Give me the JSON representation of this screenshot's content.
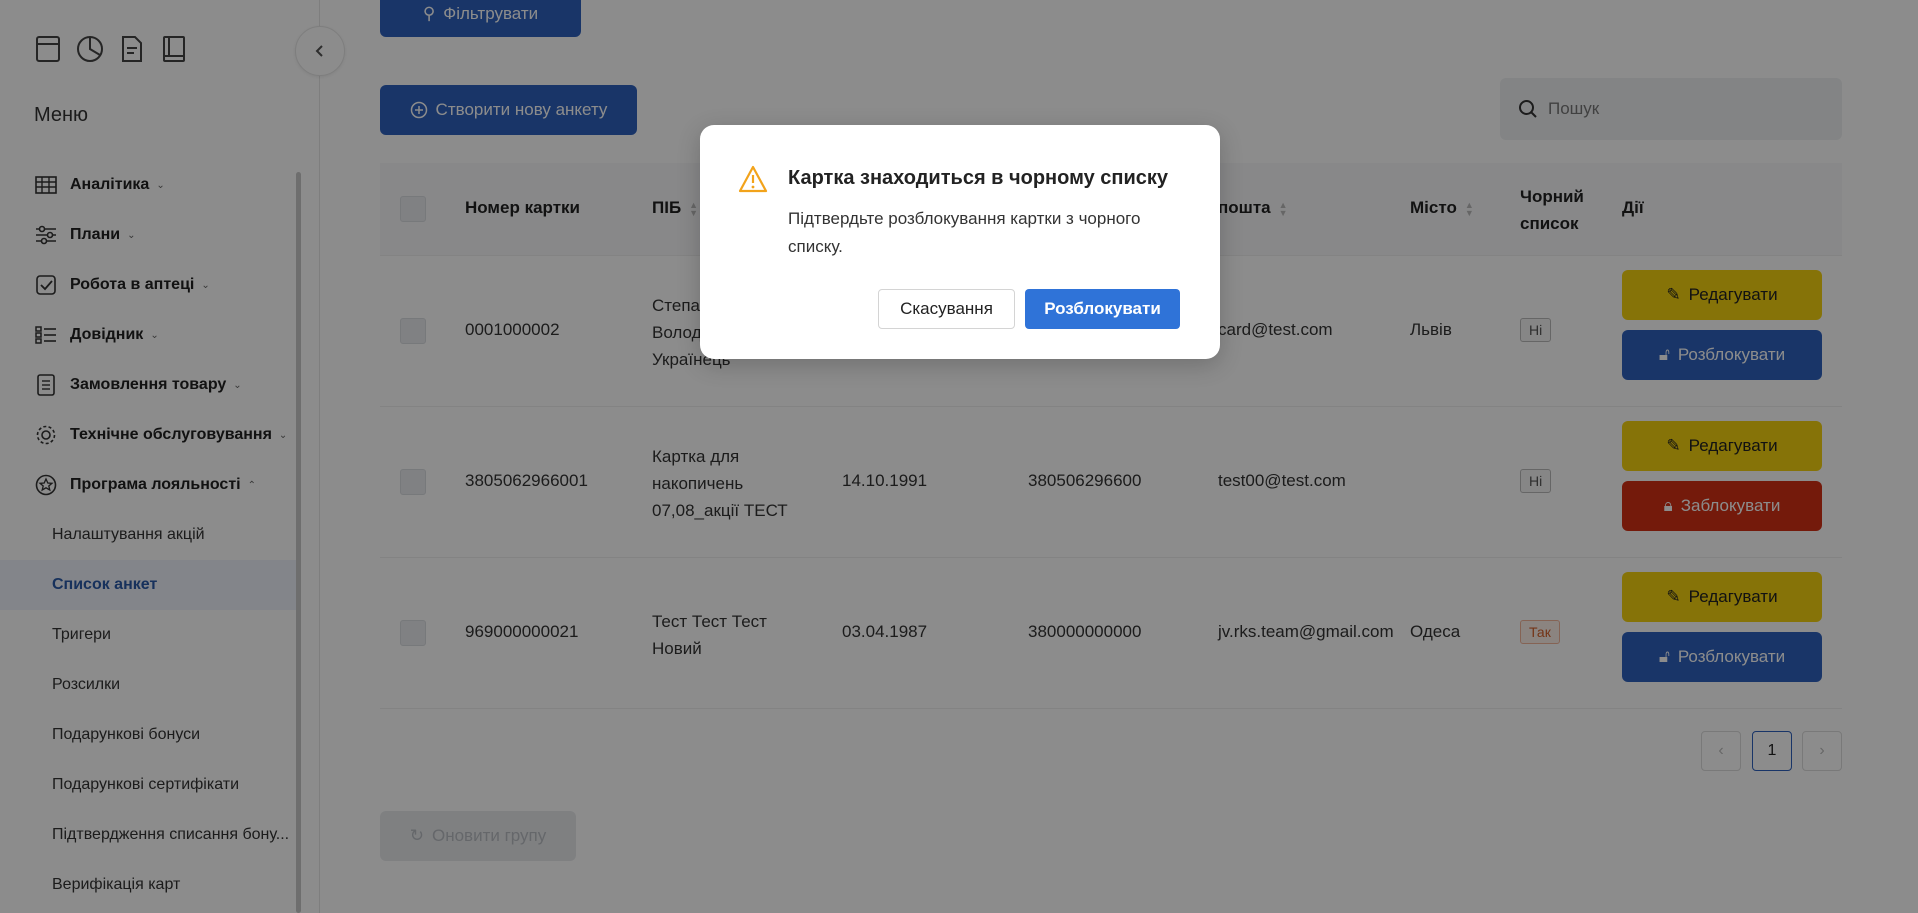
{
  "sidebar": {
    "top_icons": [
      "archive-icon",
      "pie-chart-icon",
      "document-icon",
      "book-icon"
    ],
    "menu_title": "Меню",
    "items": [
      {
        "label": "Аналітика",
        "icon": "table-grid-icon",
        "expanded": false
      },
      {
        "label": "Плани",
        "icon": "sliders-icon",
        "expanded": false
      },
      {
        "label": "Робота в аптеці",
        "icon": "checkbox-icon",
        "expanded": false
      },
      {
        "label": "Довідник",
        "icon": "list-icon",
        "expanded": false
      },
      {
        "label": "Замовлення товару",
        "icon": "clipboard-list-icon",
        "expanded": false
      },
      {
        "label": "Технічне обслуговування",
        "icon": "gear-icon",
        "expanded": false
      },
      {
        "label": "Програма лояльності",
        "icon": "star-badge-icon",
        "expanded": true
      }
    ],
    "sub_items": [
      {
        "label": "Налаштування акцій",
        "active": false
      },
      {
        "label": "Список анкет",
        "active": true
      },
      {
        "label": "Тригери",
        "active": false
      },
      {
        "label": "Розсилки",
        "active": false
      },
      {
        "label": "Подарункові бонуси",
        "active": false
      },
      {
        "label": "Подарункові сертифікати",
        "active": false
      },
      {
        "label": "Підтвердження списання бону...",
        "active": false
      },
      {
        "label": "Верифікація карт",
        "active": false
      }
    ]
  },
  "toolbar": {
    "filter_label": "Фільтрувати",
    "create_label": "Створити нову анкету",
    "search_placeholder": "Пошук"
  },
  "table": {
    "headers": {
      "card_number": "Номер картки",
      "name": "ПІБ",
      "email": "пошта",
      "city": "Місто",
      "blacklist": "Чорний список",
      "actions": "Дії"
    },
    "rows": [
      {
        "card_number": "0001000002",
        "name": "Степа... Волод... Українець",
        "name_lines": [
          "Степа",
          "Волод",
          "Українець"
        ],
        "birth_date": "",
        "phone": "",
        "email": "card@test.com",
        "city": "Львів",
        "blacklist": "Ні",
        "blacklisted": false,
        "action_primary": "Редагувати",
        "action_secondary": "Розблокувати",
        "secondary_type": "unblock"
      },
      {
        "card_number": "3805062966001",
        "name_lines": [
          "Картка для",
          "накопичень",
          "07,08_акції ТЕСТ"
        ],
        "birth_date": "14.10.1991",
        "phone": "380506296600",
        "email": "test00@test.com",
        "city": "",
        "blacklist": "Ні",
        "blacklisted": false,
        "action_primary": "Редагувати",
        "action_secondary": "Заблокувати",
        "secondary_type": "block"
      },
      {
        "card_number": "969000000021",
        "name_lines": [
          "Тест Тест Тест",
          "Новий"
        ],
        "birth_date": "03.04.1987",
        "phone": "380000000000",
        "email": "jv.rks.team@gmail.com",
        "city": "Одеса",
        "blacklist": "Так",
        "blacklisted": true,
        "action_primary": "Редагувати",
        "action_secondary": "Розблокувати",
        "secondary_type": "unblock"
      }
    ]
  },
  "pagination": {
    "prev": "‹",
    "current": "1",
    "next": "›"
  },
  "update_group_label": "Оновити групу",
  "modal": {
    "title": "Картка знаходиться в чорному списку",
    "text": "Підтвердьте розблокування картки з чорного списку.",
    "cancel_label": "Скасування",
    "confirm_label": "Розблокувати",
    "icon": "warning-triangle-icon"
  },
  "colors": {
    "primary": "#2f62be",
    "edit": "#f4d20f",
    "block": "#d33015",
    "confirm": "#2f73d8",
    "warning": "#f2a31b"
  }
}
